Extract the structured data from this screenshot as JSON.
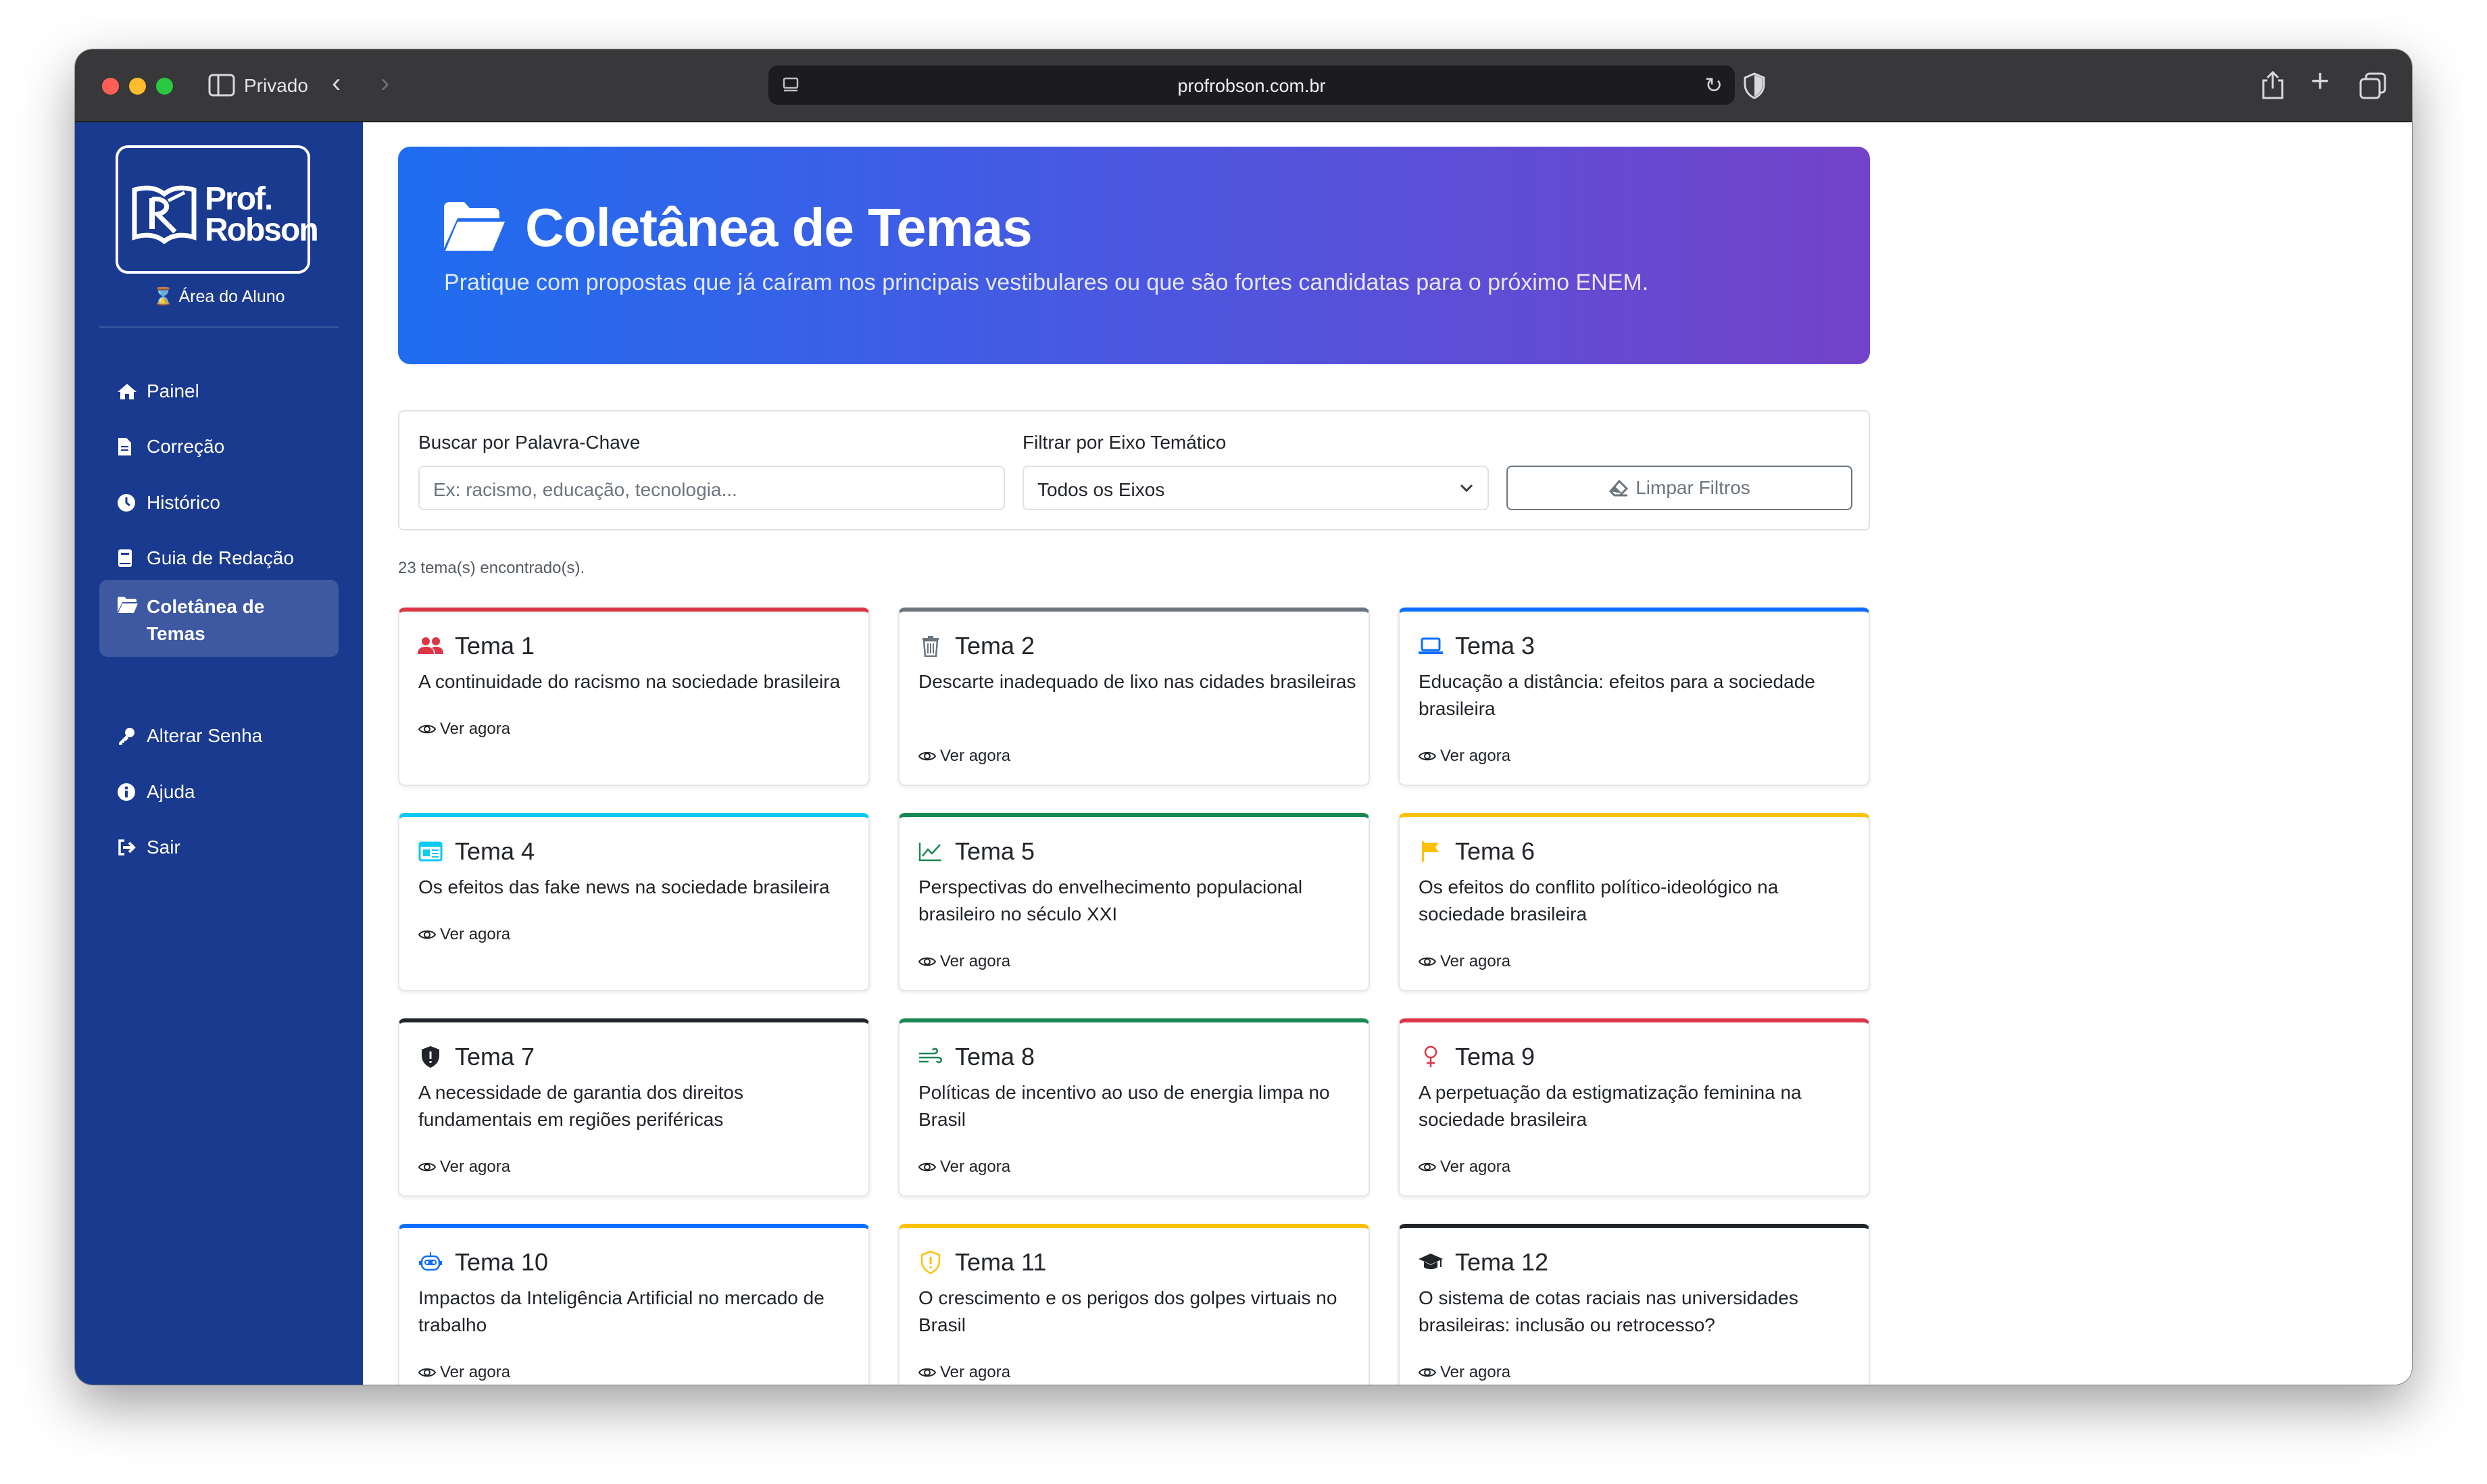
{
  "browser": {
    "private_label": "Privado",
    "url": "profrobson.com.br"
  },
  "sidebar": {
    "logo_line1": "Prof.",
    "logo_line2": "Robson",
    "area_label": "Área do Aluno",
    "items": [
      {
        "label": "Painel",
        "icon": "home-icon"
      },
      {
        "label": "Correção",
        "icon": "file-icon"
      },
      {
        "label": "Histórico",
        "icon": "clock-icon"
      },
      {
        "label": "Guia de Redação",
        "icon": "book-icon"
      },
      {
        "label": "Coletânea de Temas",
        "icon": "folder-open-icon",
        "active": true
      },
      {
        "label": "Alterar Senha",
        "icon": "key-icon"
      },
      {
        "label": "Ajuda",
        "icon": "info-icon"
      },
      {
        "label": "Sair",
        "icon": "logout-icon"
      }
    ]
  },
  "hero": {
    "title": "Coletânea de Temas",
    "subtitle": "Pratique com propostas que já caíram nos principais vestibulares ou que são fortes candidatas para o próximo ENEM."
  },
  "filters": {
    "search_label": "Buscar por Palavra-Chave",
    "search_placeholder": "Ex: racismo, educação, tecnologia...",
    "axis_label": "Filtrar por Eixo Temático",
    "axis_selected": "Todos os Eixos",
    "clear_label": "Limpar Filtros"
  },
  "results_count": "23 tema(s) encontrado(s).",
  "link_label": "Ver agora",
  "colors": {
    "red": "#dc3545",
    "gray": "#6c757d",
    "blue": "#0d6efd",
    "cyan": "#0dcaf0",
    "green": "#198754",
    "yellow": "#ffc107",
    "dark": "#212529"
  },
  "themes": [
    {
      "title": "Tema 1",
      "desc": "A continuidade do racismo na sociedade brasileira",
      "icon": "users-icon",
      "color": "#dc3545"
    },
    {
      "title": "Tema 2",
      "desc": "Descarte inadequado de lixo nas cidades brasileiras",
      "icon": "trash-icon",
      "color": "#6c757d"
    },
    {
      "title": "Tema 3",
      "desc": "Educação a distância: efeitos para a sociedade brasileira",
      "icon": "laptop-icon",
      "color": "#0d6efd"
    },
    {
      "title": "Tema 4",
      "desc": "Os efeitos das fake news na sociedade brasileira",
      "icon": "newspaper-icon",
      "color": "#0dcaf0"
    },
    {
      "title": "Tema 5",
      "desc": "Perspectivas do envelhecimento populacional brasileiro no século XXI",
      "icon": "chart-line-icon",
      "color": "#198754"
    },
    {
      "title": "Tema 6",
      "desc": "Os efeitos do conflito político-ideológico na sociedade brasileira",
      "icon": "flag-icon",
      "color": "#ffc107"
    },
    {
      "title": "Tema 7",
      "desc": "A necessidade de garantia dos direitos fundamentais em regiões periféricas",
      "icon": "shield-icon",
      "color": "#212529"
    },
    {
      "title": "Tema 8",
      "desc": "Políticas de incentivo ao uso de energia limpa no Brasil",
      "icon": "wind-icon",
      "color": "#198754"
    },
    {
      "title": "Tema 9",
      "desc": "A perpetuação da estigmatização feminina na sociedade brasileira",
      "icon": "female-icon",
      "color": "#dc3545"
    },
    {
      "title": "Tema 10",
      "desc": "Impactos da Inteligência Artificial no mercado de trabalho",
      "icon": "robot-icon",
      "color": "#0d6efd"
    },
    {
      "title": "Tema 11",
      "desc": "O crescimento e os perigos dos golpes virtuais no Brasil",
      "icon": "shield-alert-icon",
      "color": "#ffc107"
    },
    {
      "title": "Tema 12",
      "desc": "O sistema de cotas raciais nas universidades brasileiras: inclusão ou retrocesso?",
      "icon": "graduation-cap-icon",
      "color": "#212529"
    }
  ]
}
